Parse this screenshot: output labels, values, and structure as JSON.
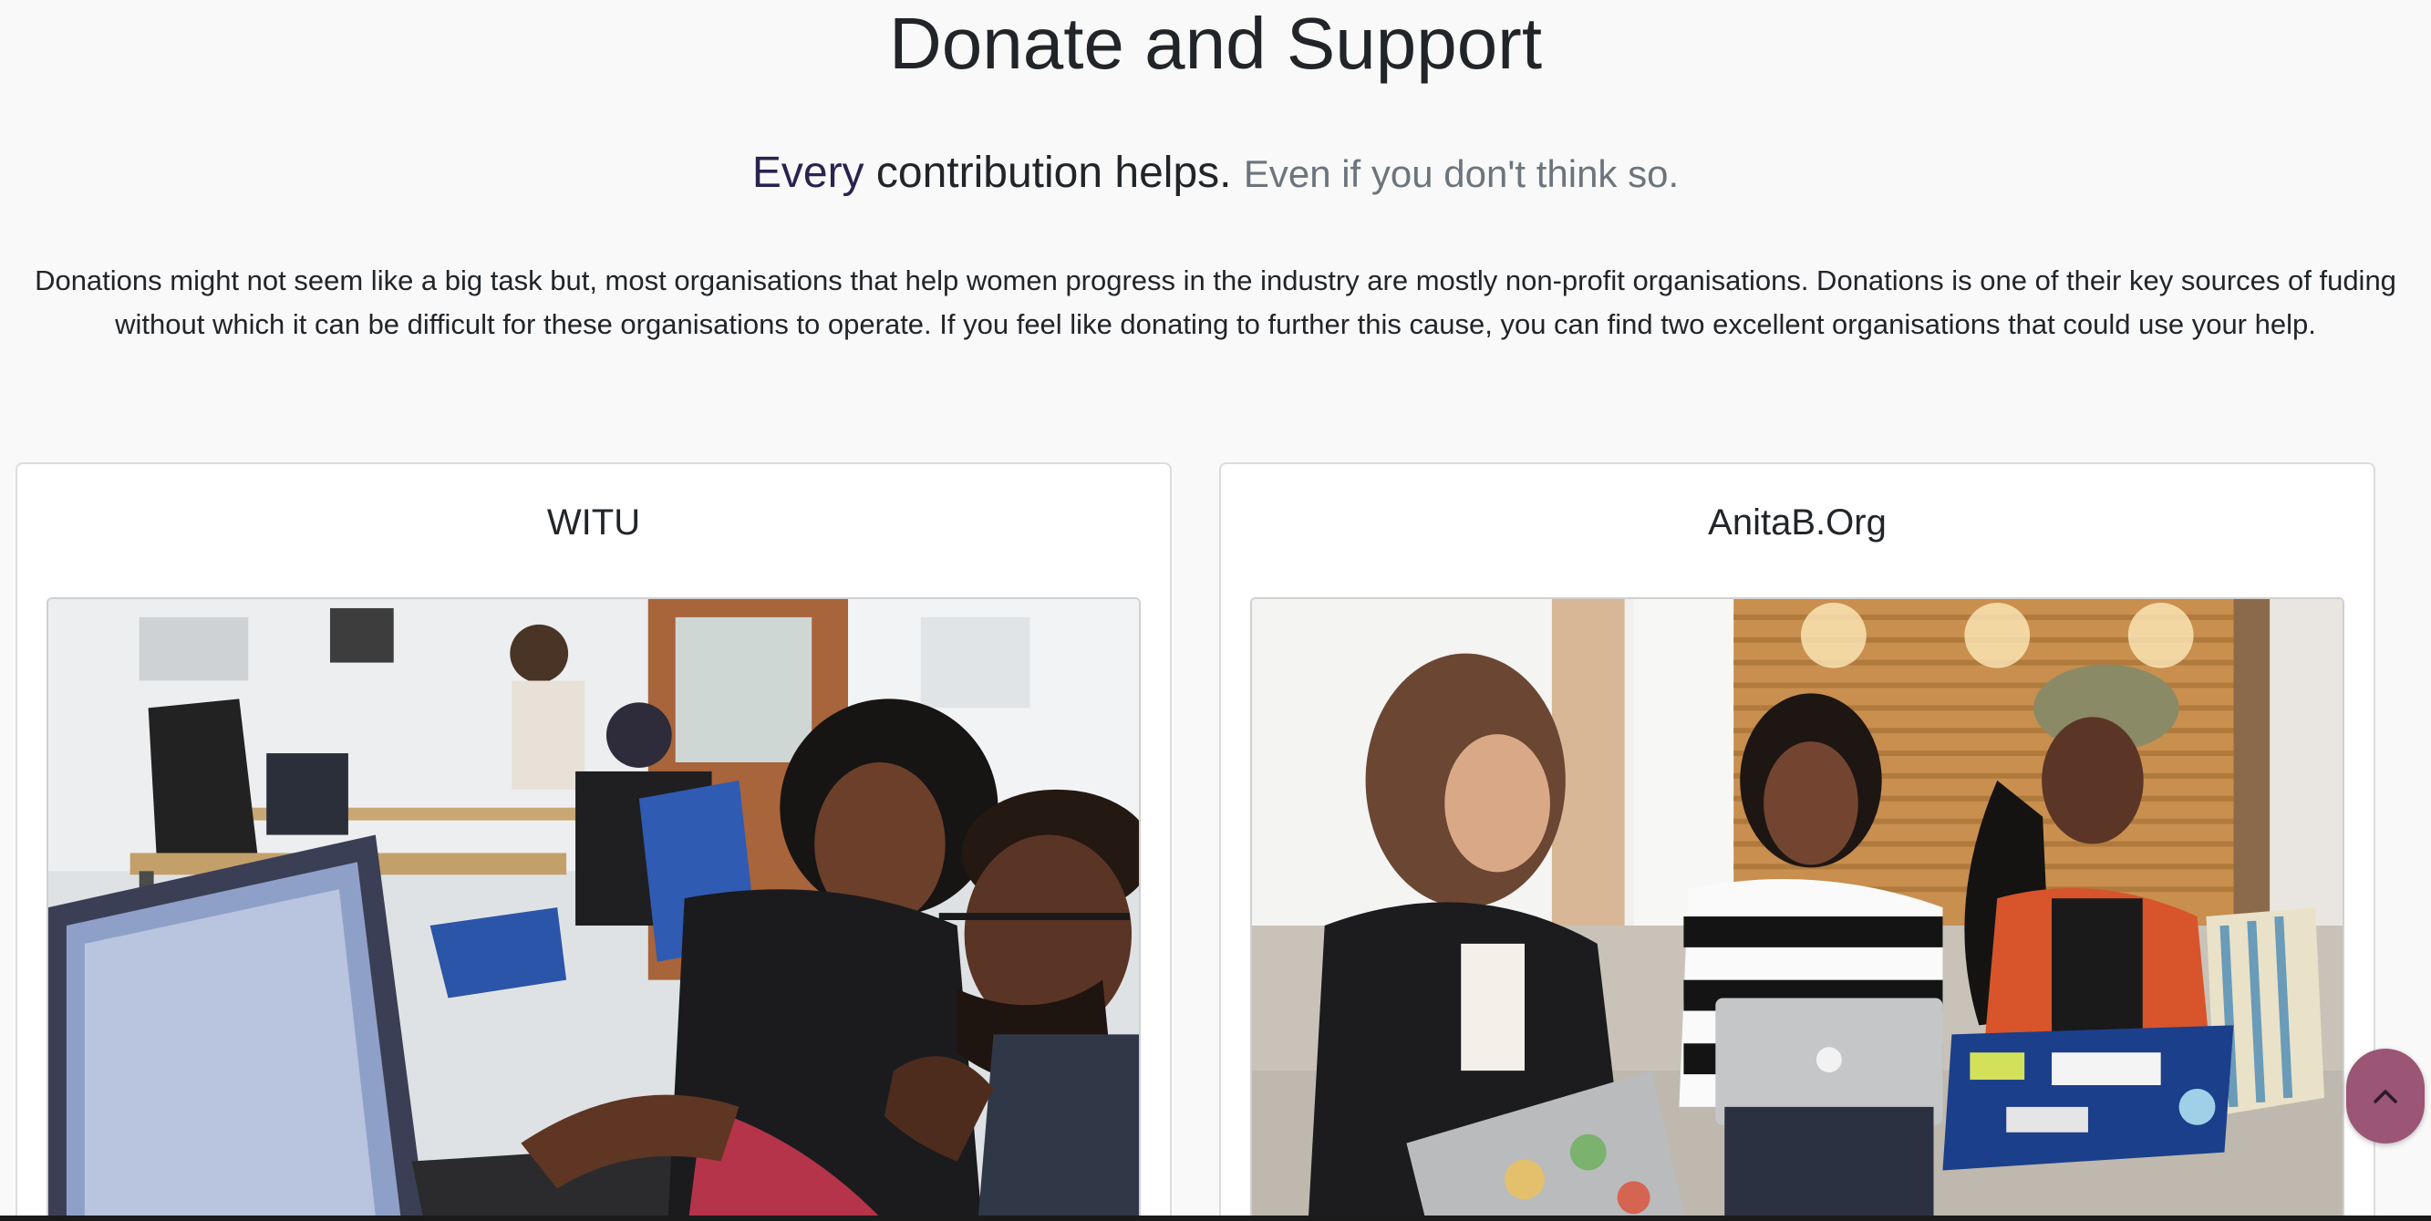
{
  "header": {
    "title": "Donate and Support",
    "subtitle_em": "Every",
    "subtitle_main": " contribution helps.",
    "subtitle_muted": "Even if you don't think so."
  },
  "intro": {
    "text": "Donations might not seem like a big task but, most organisations that help women progress in the industry are mostly non-profit organisations. Donations is one of their key sources of fuding without which it can be difficult for these organisations to operate. If you feel like donating to further this cause, you can find two excellent organisations that could use your help."
  },
  "cards": [
    {
      "title": "WITU",
      "image": "team-working-at-computers-photo"
    },
    {
      "title": "AnitaB.Org",
      "image": "women-with-laptops-on-couch-photo"
    }
  ],
  "scroll_top": {
    "icon": "chevron-up-icon",
    "color": "#9b5575"
  },
  "colors": {
    "background": "#f9f9f9",
    "accent": "#2b2250",
    "muted": "#6c757d"
  }
}
